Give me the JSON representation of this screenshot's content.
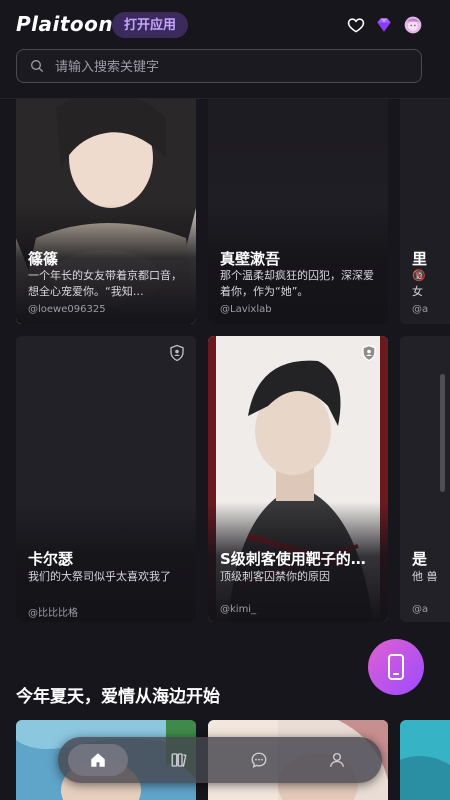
{
  "app": {
    "brand": "Plaitoon",
    "open_app_label": "打开应用"
  },
  "header_icons": [
    "heart-icon",
    "diamond-icon",
    "user-avatar"
  ],
  "search": {
    "placeholder": "请输入搜索关键字"
  },
  "cards_row1": [
    {
      "title": "篠篠",
      "desc": "一个年长的女友带着京都口音，想全心宠爱你。“我知…",
      "author": "@loewe096325"
    },
    {
      "title": "真壁漱吾",
      "desc": "那个温柔却疯狂的囚犯，深深爱着你，作为“她”。",
      "author": "@Lavixlab"
    },
    {
      "title": "里",
      "desc": "🔞 女",
      "author": "@a"
    }
  ],
  "cards_row2": [
    {
      "title": "卡尔瑟",
      "desc": "我们的大祭司似乎太喜欢我了",
      "author": "@比比比格"
    },
    {
      "title": "S级刺客使用靶子的…",
      "desc": "顶级刺客囚禁你的原因",
      "author": "@kimi_"
    },
    {
      "title": "是",
      "desc": "他 兽",
      "author": "@a"
    }
  ],
  "section": {
    "title": "今年夏天，爱情从海边开始"
  },
  "fab_icon": "phone-icon",
  "nav": [
    "home-icon",
    "library-icon",
    "chat-icon",
    "profile-icon"
  ],
  "colors": {
    "background": "#17161c",
    "accent": "#9b4bff",
    "badge_bg": "#3a2b5c",
    "badge_text": "#c9a4ff"
  }
}
